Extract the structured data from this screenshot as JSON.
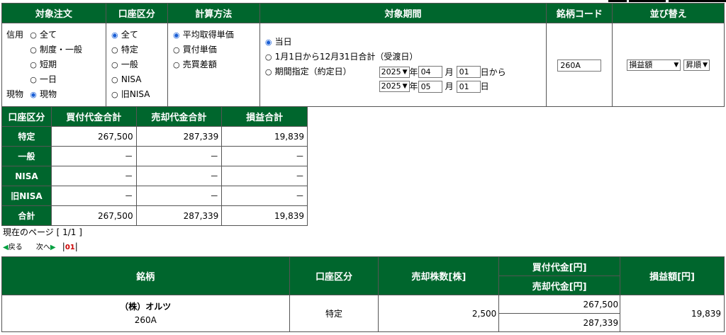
{
  "filter": {
    "headers": [
      "対象注文",
      "口座区分",
      "計算方法",
      "対象期間",
      "銘柄コード",
      "並び替え"
    ],
    "order": {
      "shinyo_label": "信用",
      "genbutsu_label": "現物",
      "shinyo_options": [
        "全て",
        "制度・一般",
        "短期",
        "一日"
      ],
      "genbutsu_options": [
        "現物"
      ]
    },
    "account": {
      "options": [
        "全て",
        "特定",
        "一般",
        "NISA",
        "旧NISA"
      ]
    },
    "method": {
      "options": [
        "平均取得単価",
        "買付単価",
        "売買差額"
      ]
    },
    "period": {
      "options": [
        "当日",
        "1月1日から12月31日合計（受渡日）",
        "期間指定（約定日）"
      ],
      "from_year": "2025",
      "from_month": "04",
      "from_day": "01",
      "to_year": "2025",
      "to_month": "05",
      "to_day": "01",
      "year_unit": "年",
      "month_unit": "月",
      "from_suffix": "日から",
      "to_suffix": "日"
    },
    "code": {
      "value": "260A"
    },
    "sort": {
      "field": "損益額",
      "order": "昇順"
    }
  },
  "summary": {
    "headers": [
      "口座区分",
      "買付代金合計",
      "売却代金合計",
      "損益合計"
    ],
    "rows": [
      {
        "label": "特定",
        "buy": "267,500",
        "sell": "287,339",
        "pl": "19,839"
      },
      {
        "label": "一般",
        "buy": "－",
        "sell": "－",
        "pl": "－"
      },
      {
        "label": "NISA",
        "buy": "－",
        "sell": "－",
        "pl": "－"
      },
      {
        "label": "旧NISA",
        "buy": "－",
        "sell": "－",
        "pl": "－"
      },
      {
        "label": "合計",
        "buy": "267,500",
        "sell": "287,339",
        "pl": "19,839"
      }
    ]
  },
  "pager": {
    "current_label": "現在のページ",
    "current_value": "[ 1/1 ]",
    "back": "戻る",
    "next": "次へ",
    "page": "01"
  },
  "detail": {
    "headers": {
      "name": "銘柄",
      "account": "口座区分",
      "qty": "売却株数[株]",
      "buy": "買付代金[円]",
      "sell": "売却代金[円]",
      "pl": "損益額[円]"
    },
    "rows": [
      {
        "name": "（株）オルツ",
        "code": "260A",
        "account": "特定",
        "qty": "2,500",
        "buy": "267,500",
        "sell": "287,339",
        "pl": "19,839"
      }
    ]
  }
}
